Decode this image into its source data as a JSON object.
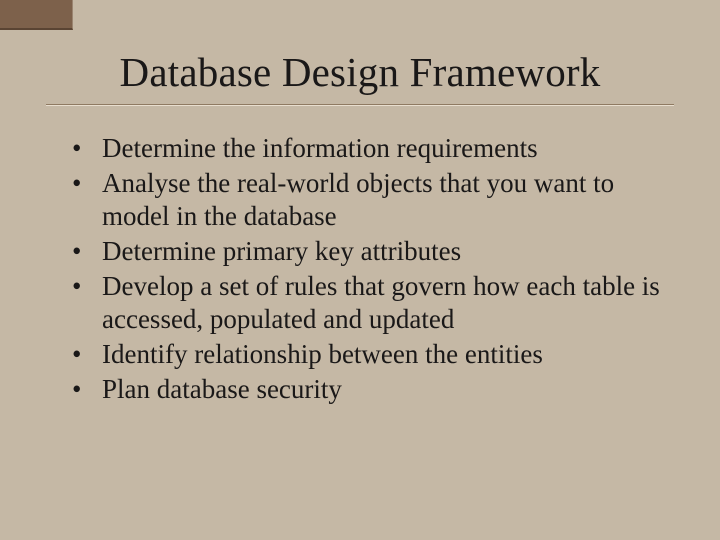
{
  "slide": {
    "title": "Database Design Framework",
    "bullets": [
      "Determine the information requirements",
      "Analyse the real-world objects that you want to model in the database",
      "Determine primary key attributes",
      "Develop a set of rules that govern how each table is accessed, populated and updated",
      "Identify relationship between the entities",
      "Plan database security"
    ]
  }
}
